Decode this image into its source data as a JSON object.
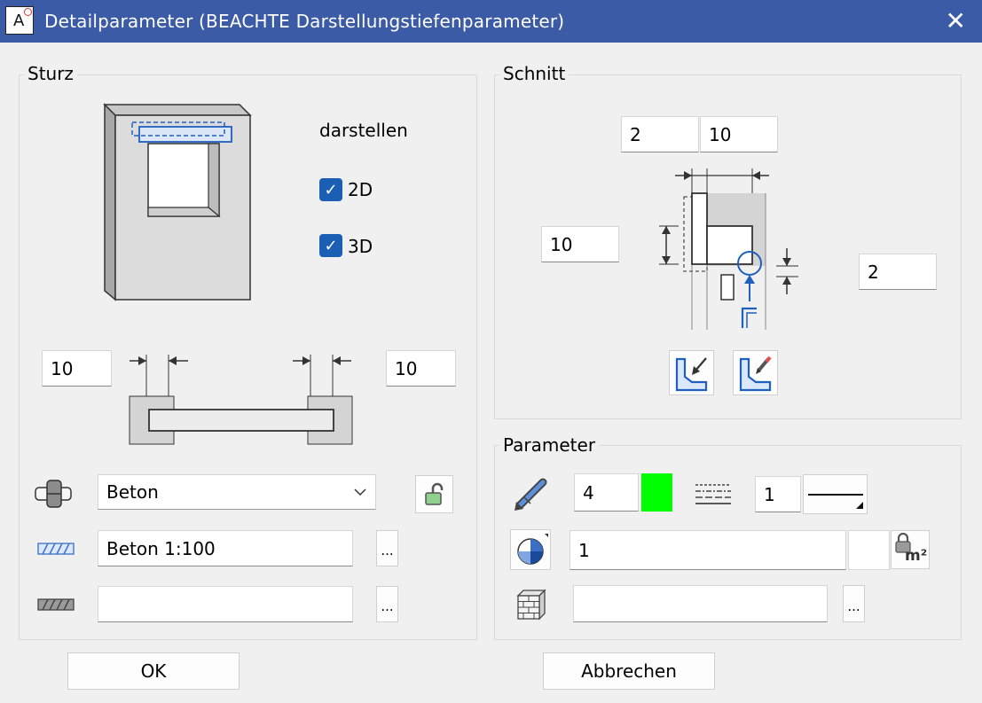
{
  "window": {
    "title": "Detailparameter (BEACHTE Darstellungstiefenparameter)",
    "close_glyph": "✕"
  },
  "sturz": {
    "label": "Sturz",
    "show_label": "darstellen",
    "check_2d": {
      "label": "2D",
      "checked": true
    },
    "check_3d": {
      "label": "3D",
      "checked": true
    },
    "left_value": "10",
    "right_value": "10",
    "material": {
      "selected": "Beton"
    },
    "hatch": {
      "value": "Beton 1:100"
    },
    "pattern": {
      "value": ""
    },
    "more_glyph": "..."
  },
  "schnitt": {
    "label": "Schnitt",
    "top_left_value": "2",
    "top_right_value": "10",
    "left_value": "10",
    "right_value": "2"
  },
  "parameter": {
    "label": "Parameter",
    "pen_value": "4",
    "pen_color": "#00ff00",
    "line_value": "1",
    "layer_value": "1",
    "layer_extra": "",
    "area_unit": "m²",
    "surface_value": "",
    "more_glyph": "..."
  },
  "buttons": {
    "ok": "OK",
    "cancel": "Abbrechen"
  },
  "colors": {
    "titlebar": "#3b5ba6",
    "accent": "#1a5fb4",
    "icon_blue": "#1f5fbf"
  }
}
